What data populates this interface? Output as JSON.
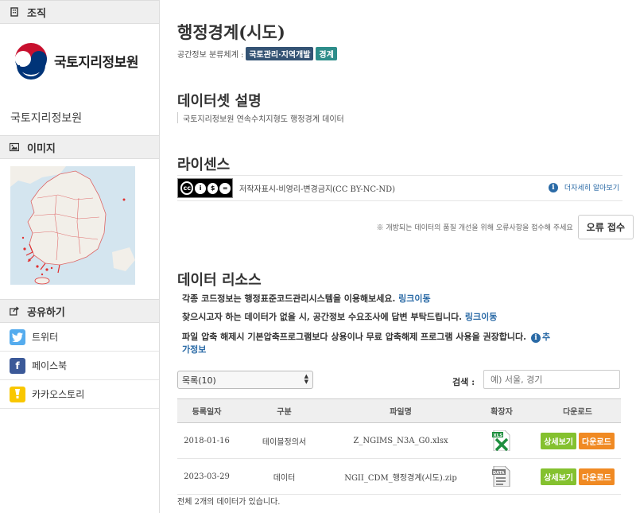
{
  "sidebar": {
    "org_header": "조직",
    "org_logo_text": "국토지리정보원",
    "org_name": "국토지리정보원",
    "image_header": "이미지",
    "share_header": "공유하기",
    "share_items": [
      {
        "label": "트위터",
        "icon": "twitter-icon",
        "color": "#55acee",
        "glyph": "t"
      },
      {
        "label": "페이스북",
        "icon": "facebook-icon",
        "color": "#3b5998",
        "glyph": "f"
      },
      {
        "label": "카카오스토리",
        "icon": "kakaostory-icon",
        "color": "#f9c700",
        "glyph": "k"
      }
    ]
  },
  "main": {
    "title": "행정경계(시도)",
    "classification_label": "공간정보 분류체계 :",
    "tags": [
      "국토관리·지역개발",
      "경계"
    ],
    "desc_title": "데이터셋 설명",
    "desc_text": "국토지리정보원 연속수치지형도 행정경계 데이터",
    "license_title": "라이센스",
    "license_text": "저작자표시-비영리-변경금지(CC BY-NC-ND)",
    "license_more": "더자세히 알아보기",
    "error_note": "※ 개방되는 데이터의 품질 개선을 위해 오류사항을 접수해 주세요",
    "error_button": "오류 접수",
    "resource_title": "데이터 리소스",
    "notice1_text": "각종 코드정보는 행정표준코드관리시스템을 이용해보세요.",
    "notice1_link": "링크이동",
    "notice2_text": "찾으시고자 하는 데이터가 없을 시, 공간정보 수요조사에 답변 부탁드립니다.",
    "notice2_link": "링크이동",
    "notice3_text": "파일 압축 해제시 기본압축프로그램보다 상용이나 무료 압축해제 프로그램 사용을 권장합니다.",
    "notice3_link1": "추",
    "notice3_link2": "가정보",
    "select_value": "목록(10)",
    "search_label": "검색 :",
    "search_placeholder": "예) 서울, 경기",
    "columns": [
      "등록일자",
      "구분",
      "파일명",
      "확장자",
      "다운로드"
    ],
    "rows": [
      {
        "date": "2018-01-16",
        "type": "테이블정의서",
        "file": "Z_NGIMS_N3A_G0.xlsx",
        "ext_icon": "xlsx-file-icon",
        "ext_label": "XLS"
      },
      {
        "date": "2023-03-29",
        "type": "데이터",
        "file": "NGII_CDM_행정경계(시도).zip",
        "ext_icon": "zip-file-icon",
        "ext_label": "DATA"
      }
    ],
    "detail_button": "상세보기",
    "download_button": "다운로드",
    "total_text": "전체 2개의 데이터가 있습니다."
  }
}
